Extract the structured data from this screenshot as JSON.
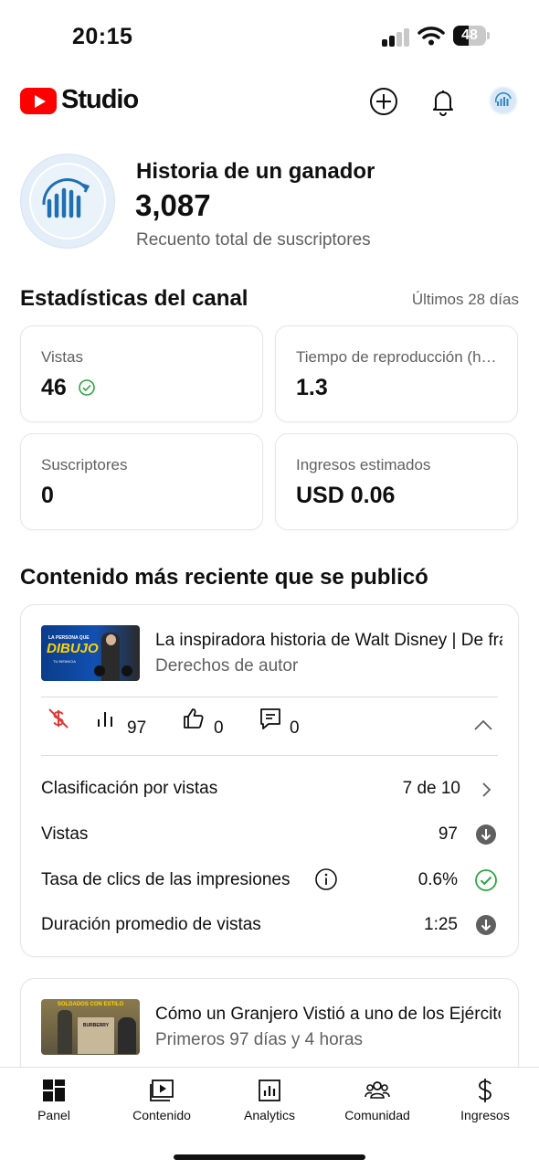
{
  "status_bar": {
    "time": "20:15",
    "battery": "48",
    "battery_level": 0.48
  },
  "header": {
    "logo_text": "Studio",
    "icons": [
      "create-icon",
      "notifications-icon",
      "account-avatar"
    ]
  },
  "channel": {
    "name": "Historia de un ganador",
    "subscribers": "3,087",
    "subscribers_label": "Recuento total de suscriptores"
  },
  "stats": {
    "title": "Estadísticas del canal",
    "period": "Últimos 28 días",
    "cards": [
      {
        "label": "Vistas",
        "value": "46"
      },
      {
        "label": "Tiempo de reproducción (horas)",
        "value": "1.3"
      },
      {
        "label": "Suscriptores",
        "value": "0"
      },
      {
        "label": "Ingresos estimados",
        "value": "USD 0.06"
      }
    ]
  },
  "recent": {
    "title": "Contenido más reciente que se publicó",
    "video": {
      "thumb_top_text": "LA PERSONA QUE",
      "thumb_main_text": "DIBUJO",
      "thumb_bottom_text": "TU INFANCIA",
      "title": "La inspiradora historia de Walt Disney | De fracaso a leyenda",
      "subtitle": "Derechos de autor",
      "views": "97",
      "likes": "0",
      "comments": "0",
      "rows": [
        {
          "label": "Clasificación por vistas",
          "value": "7 de 10"
        },
        {
          "label": "Vistas",
          "value": "97"
        },
        {
          "label": "Tasa de clics de las impresiones",
          "value": "0.6%"
        },
        {
          "label": "Duración promedio de vistas",
          "value": "1:25"
        }
      ]
    },
    "second_video": {
      "thumb_top_text": "SOLDADOS CON ESTILO",
      "thumb_brand_text": "BURBERRY",
      "title": "Cómo un Granjero Vistió a uno de los Ejércitos más grandes",
      "subtitle": "Primeros 97 días y 4 horas"
    }
  },
  "nav": {
    "items": [
      "Panel",
      "Contenido",
      "Analytics",
      "Comunidad",
      "Ingresos"
    ]
  },
  "colors": {
    "accent_red": "#ff0000",
    "success_green": "#2ba640",
    "text_secondary": "#606060"
  }
}
